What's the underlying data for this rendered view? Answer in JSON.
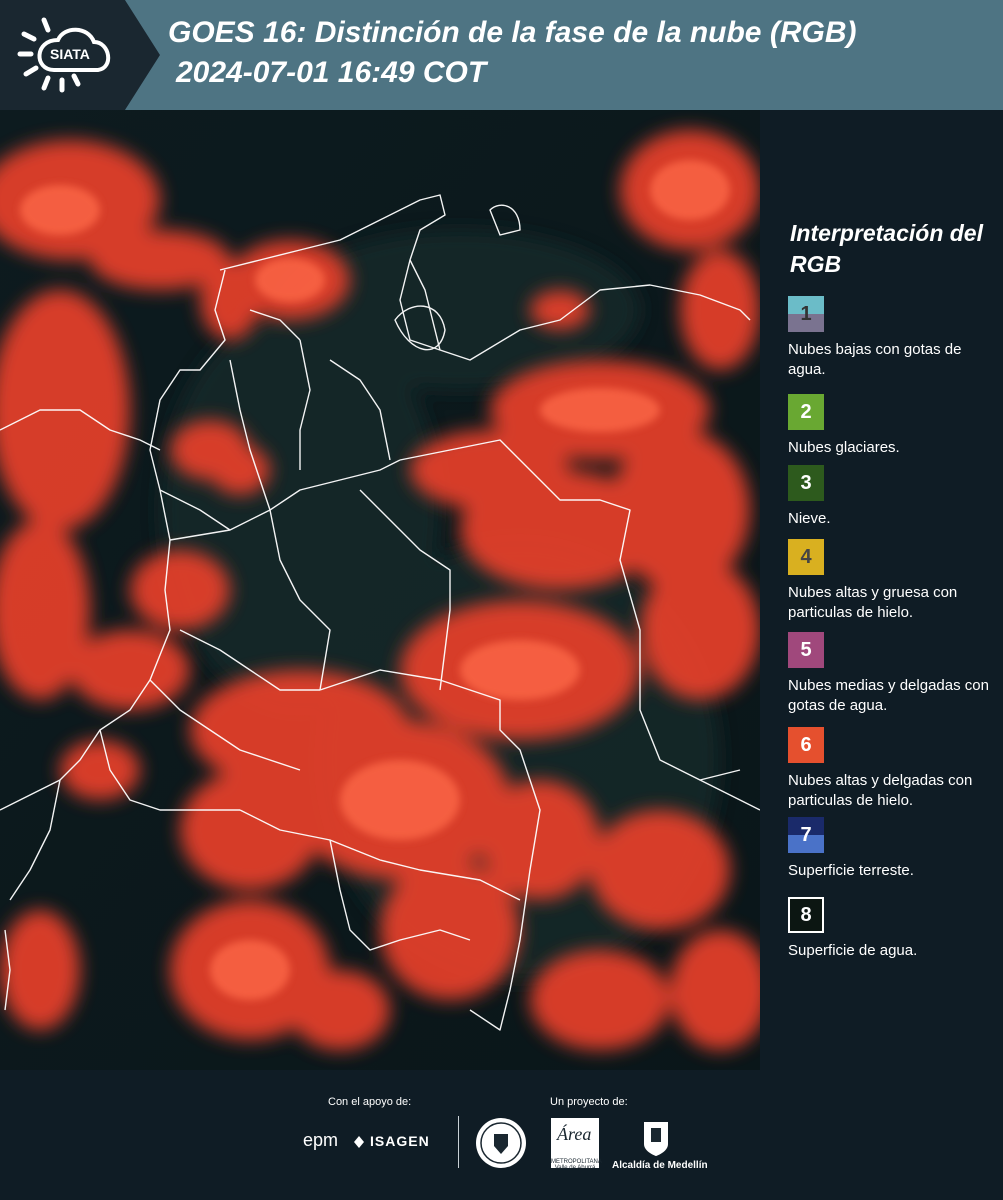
{
  "header": {
    "logo_text": "SIATA",
    "title_line1": "GOES 16: Distinción de la fase de la nube (RGB)",
    "title_line2": "2024-07-01 16:49 COT"
  },
  "legend": {
    "title": "Interpretación del RGB",
    "items": [
      {
        "number": "1",
        "label": "Nubes bajas con gotas de agua.",
        "color_top": "#6bbcc8",
        "color_bottom": "#7a7390",
        "text_color": "#333333"
      },
      {
        "number": "2",
        "label": "Nubes glaciares.",
        "color_top": "#69a832",
        "color_bottom": "#69a832",
        "text_color": "#ffffff"
      },
      {
        "number": "3",
        "label": "Nieve.",
        "color_top": "#2d5a1d",
        "color_bottom": "#2d5a1d",
        "text_color": "#ffffff"
      },
      {
        "number": "4",
        "label": "Nubes altas y gruesa con particulas de hielo.",
        "color_top": "#d9b020",
        "color_bottom": "#d9b020",
        "text_color": "#444444"
      },
      {
        "number": "5",
        "label": "Nubes medias y delgadas con gotas de agua.",
        "color_top": "#a0487c",
        "color_bottom": "#a0487c",
        "text_color": "#ffffff"
      },
      {
        "number": "6",
        "label": "Nubes altas y delgadas con particulas de hielo.",
        "color_top": "#e5502e",
        "color_bottom": "#e5502e",
        "text_color": "#ffffff"
      },
      {
        "number": "7",
        "label": "Superficie terreste.",
        "color_top": "#1a2a6a",
        "color_bottom": "#4a72c8",
        "text_color": "#ffffff"
      },
      {
        "number": "8",
        "label": "Superficie de agua.",
        "color_top": "#0c1612",
        "color_bottom": "#0c1612",
        "text_color": "#ffffff"
      }
    ]
  },
  "footer": {
    "support_label": "Con el apoyo de:",
    "project_label": "Un proyecto de:",
    "sponsor_epm": "epm",
    "sponsor_isagen": "ISAGEN",
    "partner_amva_name": "Área",
    "partner_amva_sub": "METROPOLITANA Valle de Aburrá",
    "partner_medellin": "Alcaldía de Medellín"
  },
  "colors": {
    "header_bg": "#2c3e48",
    "panel_bg": "#0f1c25",
    "cloud_red": "#e8402a"
  }
}
